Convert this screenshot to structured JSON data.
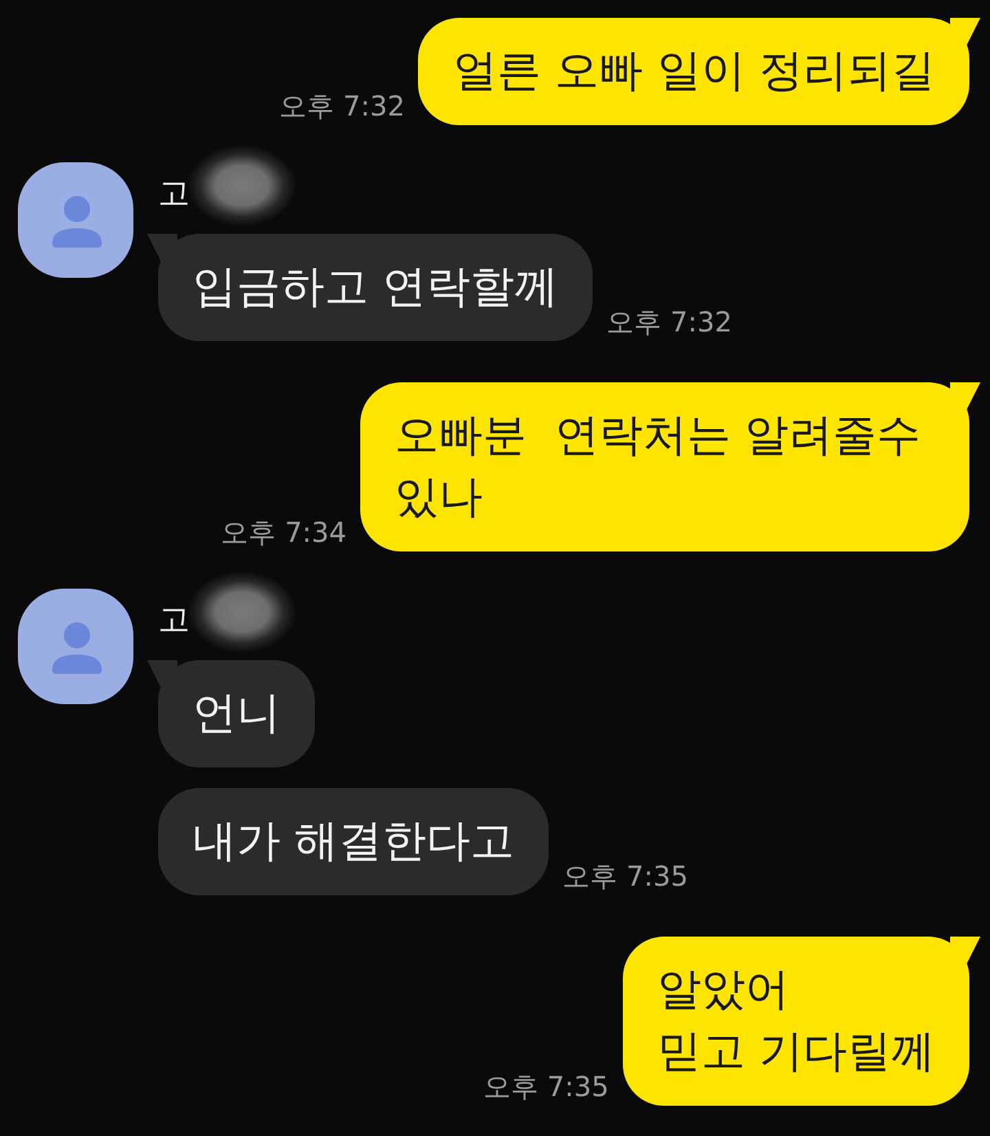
{
  "chat": [
    {
      "kind": "outgoing",
      "text": "얼른 오빠 일이 정리되길",
      "time": "오후 7:32"
    },
    {
      "kind": "incoming_group",
      "sender": {
        "name": "고",
        "redacted": true
      },
      "messages": [
        {
          "text": "입금하고 연락할께",
          "time": "오후 7:32"
        }
      ]
    },
    {
      "kind": "outgoing",
      "text": "오빠분  연락처는 알려줄수 있나",
      "time": "오후 7:34"
    },
    {
      "kind": "incoming_group",
      "sender": {
        "name": "고",
        "redacted": true
      },
      "messages": [
        {
          "text": "언니"
        },
        {
          "text": "내가 해결한다고",
          "time": "오후 7:35"
        }
      ]
    },
    {
      "kind": "outgoing",
      "text": "알았어\n믿고 기다릴께",
      "time": "오후 7:35"
    }
  ]
}
